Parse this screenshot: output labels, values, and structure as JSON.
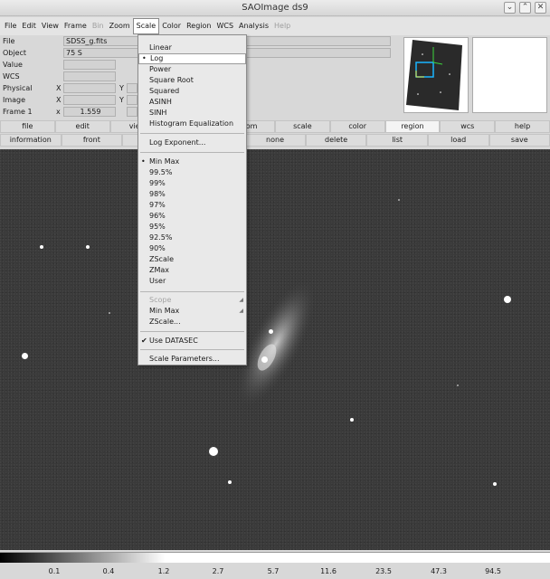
{
  "window": {
    "title": "SAOImage ds9",
    "controls": [
      "⌄",
      "⌃",
      "✕"
    ]
  },
  "menubar": [
    "File",
    "Edit",
    "View",
    "Frame",
    "Bin",
    "Zoom",
    "Scale",
    "Color",
    "Region",
    "WCS",
    "Analysis",
    "Help"
  ],
  "menubar_disabled": [
    "Bin",
    "Help"
  ],
  "menubar_active": "Scale",
  "info": {
    "file_label": "File",
    "file_value": "SDSS_g.fits",
    "object_label": "Object",
    "object_value": "75 S",
    "value_label": "Value",
    "value_value": "",
    "wcs_label": "WCS",
    "wcs_value": "",
    "physical_label": "Physical",
    "image_label": "Image",
    "frame_label": "Frame 1",
    "zoom_label": "x",
    "zoom_value": "1.559",
    "x_label": "X",
    "y_label": "Y"
  },
  "button_bar_1": [
    "file",
    "edit",
    "view",
    "",
    "zoom",
    "scale",
    "color",
    "region",
    "wcs",
    "help"
  ],
  "button_bar_1_selected": "region",
  "button_bar_2": [
    "information",
    "front",
    "",
    "",
    "none",
    "delete",
    "list",
    "load",
    "save"
  ],
  "scale_menu": {
    "group1": [
      {
        "label": "Linear",
        "mark": ""
      },
      {
        "label": "Log",
        "mark": "•"
      },
      {
        "label": "Power",
        "mark": ""
      },
      {
        "label": "Square Root",
        "mark": ""
      },
      {
        "label": "Squared",
        "mark": ""
      },
      {
        "label": "ASINH",
        "mark": ""
      },
      {
        "label": "SINH",
        "mark": ""
      },
      {
        "label": "Histogram Equalization",
        "mark": ""
      }
    ],
    "log_exponent": "Log Exponent...",
    "group2": [
      {
        "label": "Min Max",
        "mark": "•"
      },
      {
        "label": "99.5%",
        "mark": ""
      },
      {
        "label": "99%",
        "mark": ""
      },
      {
        "label": "98%",
        "mark": ""
      },
      {
        "label": "97%",
        "mark": ""
      },
      {
        "label": "96%",
        "mark": ""
      },
      {
        "label": "95%",
        "mark": ""
      },
      {
        "label": "92.5%",
        "mark": ""
      },
      {
        "label": "90%",
        "mark": ""
      },
      {
        "label": "ZScale",
        "mark": ""
      },
      {
        "label": "ZMax",
        "mark": ""
      },
      {
        "label": "User",
        "mark": ""
      }
    ],
    "scope": "Scope",
    "minmax_sub": "Min Max",
    "zscale_sub": "ZScale...",
    "use_datasec": "Use DATASEC",
    "use_datasec_mark": "✔",
    "scale_parameters": "Scale Parameters..."
  },
  "colorbar": {
    "labels": [
      "0.1",
      "0.4",
      "1.2",
      "2.7",
      "5.7",
      "11.6",
      "23.5",
      "47.3",
      "94.5"
    ]
  },
  "colors": {
    "background": "#d8d8d8",
    "canvas": "#3a3a3a"
  }
}
